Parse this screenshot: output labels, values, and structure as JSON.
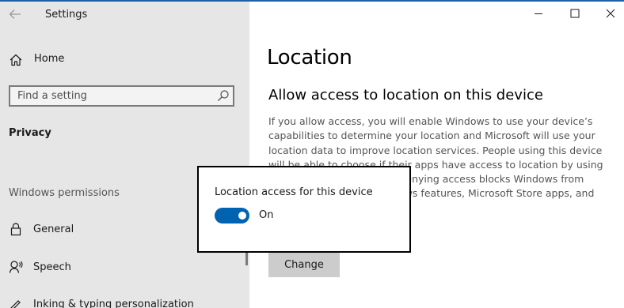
{
  "window": {
    "app_title": "Settings",
    "accent_color": "#1e5fa8"
  },
  "titlebar": {
    "controls": [
      {
        "name": "minimize",
        "icon": "minimize-icon"
      },
      {
        "name": "maximize",
        "icon": "maximize-icon"
      },
      {
        "name": "close",
        "icon": "close-icon"
      }
    ]
  },
  "sidebar": {
    "back_icon": "back-arrow-icon",
    "home": {
      "label": "Home",
      "icon": "home-icon"
    },
    "search": {
      "placeholder": "Find a setting",
      "value": "",
      "icon": "search-icon"
    },
    "section_title": "Privacy",
    "group_label": "Windows permissions",
    "items": [
      {
        "label": "General",
        "icon": "lock-icon"
      },
      {
        "label": "Speech",
        "icon": "speech-icon"
      },
      {
        "label": "Inking & typing personalization",
        "icon": "inking-icon"
      }
    ]
  },
  "main": {
    "page_title": "Location",
    "section_heading": "Allow access to location on this device",
    "description_lines": [
      "If you allow access, you will enable Windows to use your device’s",
      "capabilities to determine your location and Microsoft will use your",
      "location data to improve location services. People using this device",
      "will be able to choose if their apps have access to location by using",
      "the settings on this page. Denying access blocks Windows from",
      "providing location to Windows features, Microsoft Store apps, and"
    ],
    "change_button": "Change"
  },
  "popup": {
    "label": "Location access for this device",
    "toggle_on": true,
    "toggle_state": "On",
    "toggle_color": "#0063b1"
  }
}
